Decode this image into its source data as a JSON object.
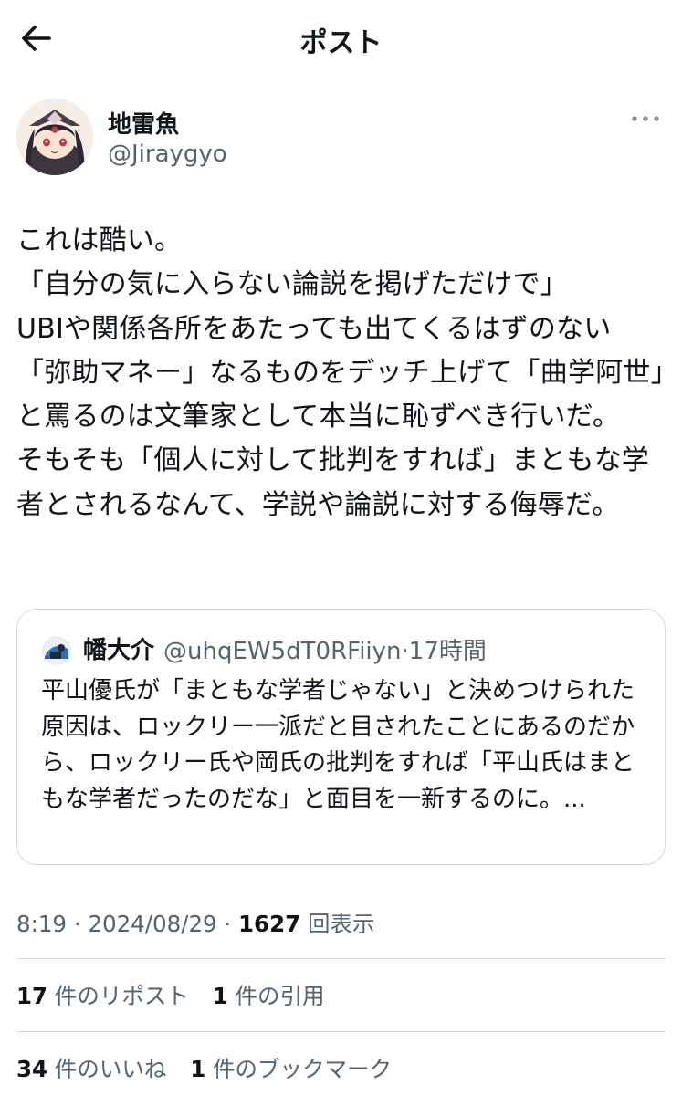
{
  "header": {
    "title": "ポスト"
  },
  "author": {
    "display_name": "地雷魚",
    "handle": "@Jiraygyo"
  },
  "post": {
    "text": "これは酷い。\n「自分の気に入らない論説を掲げただけで」\nUBIや関係各所をあたっても出てくるはずのない「弥助マネー」なるものをデッチ上げて「曲学阿世」と罵るのは文筆家として本当に恥ずべき行いだ。\nそもそも「個人に対して批判をすれば」まともな学者とされるなんて、学説や論説に対する侮辱だ。"
  },
  "quote": {
    "name": "幡大介",
    "handle": "@uhqEW5dT0RFiiyn",
    "time": "17時間",
    "text": "平山優氏が「まともな学者じゃない」と決めつけられた原因は、ロックリー一派だと目されたことにあるのだから、ロックリー氏や岡氏の批判をすれば「平山氏はまともな学者だったのだな」と面目を一新するのに。..."
  },
  "meta": {
    "time": "8:19",
    "date": "2024/08/29",
    "views": "1627",
    "views_label": "回表示"
  },
  "stats": {
    "reposts_count": "17",
    "reposts_label": "件のリポスト",
    "quotes_count": "1",
    "quotes_label": "件の引用",
    "likes_count": "34",
    "likes_label": "件のいいね",
    "bookmarks_count": "1",
    "bookmarks_label": "件のブックマーク"
  },
  "colors": {
    "text": "#0f1419",
    "secondary": "#536471",
    "border": "#cfd9de"
  },
  "icons": {
    "back": "arrow-left-icon",
    "more": "more-horizontal-icon"
  }
}
